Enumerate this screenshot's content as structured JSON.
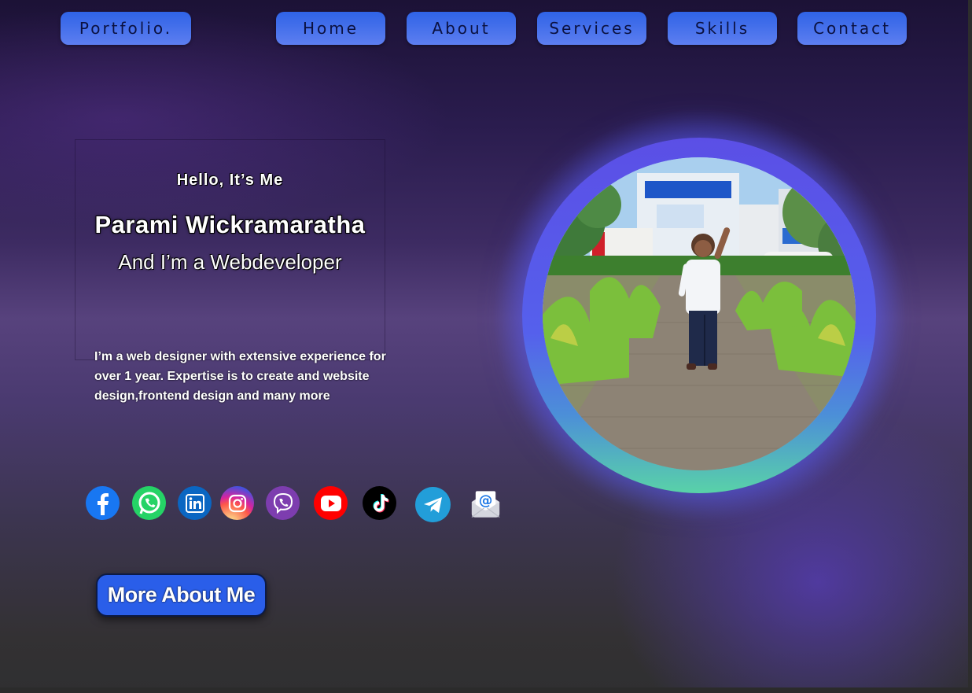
{
  "nav": {
    "logo": "Portfolio.",
    "items": [
      "Home",
      "About",
      "Services",
      "Skills",
      "Contact"
    ]
  },
  "hero": {
    "greeting": "Hello, It’s Me",
    "name": "Parami Wickramaratha",
    "role": "And I’m a Webdeveloper",
    "description": "I’m a web designer with extensive experience for over 1 year. Expertise is to create and website design,frontend design and many more"
  },
  "socials": [
    "facebook-icon",
    "whatsapp-icon",
    "linkedin-icon",
    "instagram-icon",
    "viber-icon",
    "youtube-icon",
    "tiktok-icon",
    "telegram-icon",
    "email-icon"
  ],
  "cta": {
    "label": "More About Me"
  },
  "colors": {
    "accent": "#2a5ee9",
    "nav_text": "#0b1140",
    "ring": "#5b4fe6"
  }
}
